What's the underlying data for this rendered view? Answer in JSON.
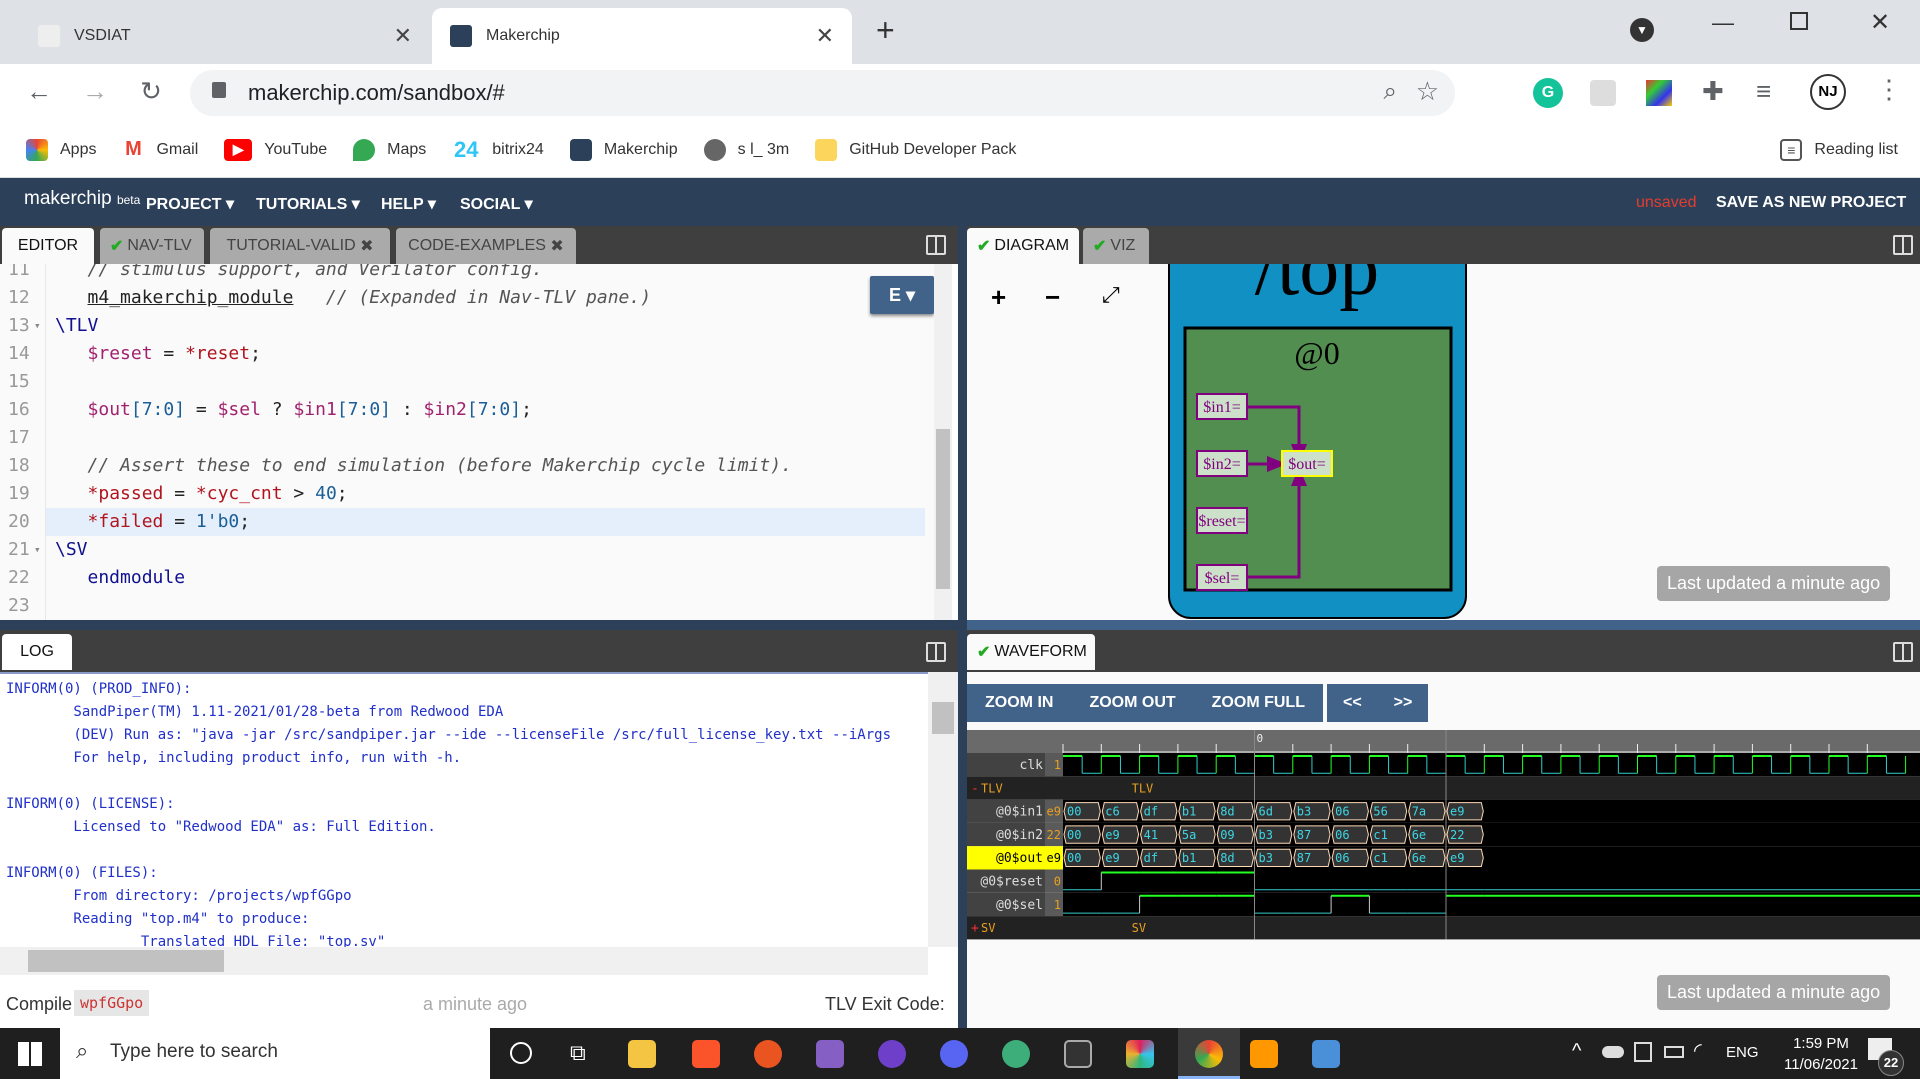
{
  "browser": {
    "tabs": [
      {
        "title": "VSDIAT",
        "active": false
      },
      {
        "title": "Makerchip",
        "active": true
      }
    ],
    "url": "makerchip.com/sandbox/#",
    "bookmarks": [
      {
        "label": "Apps",
        "icon": "apps-grid-icon"
      },
      {
        "label": "Gmail",
        "icon": "gmail-icon"
      },
      {
        "label": "YouTube",
        "icon": "youtube-icon"
      },
      {
        "label": "Maps",
        "icon": "maps-icon"
      },
      {
        "label": "bitrix24",
        "icon": "bitrix24-icon"
      },
      {
        "label": "Makerchip",
        "icon": "makerchip-icon"
      },
      {
        "label": "s l_ 3m",
        "icon": "globe-icon"
      },
      {
        "label": "GitHub Developer Pack",
        "icon": "folder-icon"
      }
    ],
    "reading_list": "Reading list",
    "profile": "NJ"
  },
  "app": {
    "logo": "makerchip",
    "beta": "beta",
    "menu": [
      "PROJECT",
      "TUTORIALS",
      "HELP",
      "SOCIAL"
    ],
    "unsaved": "unsaved",
    "save_as": "SAVE AS NEW PROJECT",
    "accent": "#2c4159"
  },
  "editor": {
    "tabs": [
      {
        "label": "EDITOR",
        "active": true,
        "check": false,
        "close": false
      },
      {
        "label": "NAV-TLV",
        "check": true,
        "close": false
      },
      {
        "label": "TUTORIAL-VALID",
        "check": false,
        "close": true
      },
      {
        "label": "CODE-EXAMPLES",
        "check": false,
        "close": true
      }
    ],
    "e_button": "E",
    "lines": [
      {
        "n": "11",
        "tokens": [
          [
            "   // stimulus support, and Verilator config.",
            "comment"
          ]
        ]
      },
      {
        "n": "12",
        "tokens": [
          [
            "   ",
            "plain"
          ],
          [
            "m4_makerchip_module",
            "link"
          ],
          [
            "   // (Expanded in Nav-TLV pane.)",
            "comment"
          ]
        ]
      },
      {
        "n": "13",
        "fold": true,
        "tokens": [
          [
            "\\TLV",
            "kw"
          ]
        ]
      },
      {
        "n": "14",
        "tokens": [
          [
            "   ",
            "plain"
          ],
          [
            "$reset",
            "var"
          ],
          [
            " = ",
            "plain"
          ],
          [
            "*reset",
            "sig"
          ],
          [
            ";",
            "plain"
          ]
        ]
      },
      {
        "n": "15",
        "tokens": []
      },
      {
        "n": "16",
        "tokens": [
          [
            "   ",
            "plain"
          ],
          [
            "$out",
            "var"
          ],
          [
            "[7:0]",
            "num"
          ],
          [
            " = ",
            "plain"
          ],
          [
            "$sel",
            "var"
          ],
          [
            " ? ",
            "plain"
          ],
          [
            "$in1",
            "var"
          ],
          [
            "[7:0]",
            "num"
          ],
          [
            " : ",
            "plain"
          ],
          [
            "$in2",
            "var"
          ],
          [
            "[7:0]",
            "num"
          ],
          [
            ";",
            "plain"
          ]
        ]
      },
      {
        "n": "17",
        "tokens": []
      },
      {
        "n": "18",
        "tokens": [
          [
            "   // Assert these to end simulation (before Makerchip cycle limit).",
            "comment"
          ]
        ]
      },
      {
        "n": "19",
        "tokens": [
          [
            "   ",
            "plain"
          ],
          [
            "*passed",
            "sig"
          ],
          [
            " = ",
            "plain"
          ],
          [
            "*cyc_cnt",
            "sig"
          ],
          [
            " > ",
            "plain"
          ],
          [
            "40",
            "num"
          ],
          [
            ";",
            "plain"
          ]
        ]
      },
      {
        "n": "20",
        "highlight": true,
        "tokens": [
          [
            "   ",
            "plain"
          ],
          [
            "*failed",
            "sig"
          ],
          [
            " = ",
            "plain"
          ],
          [
            "1'b0",
            "num"
          ],
          [
            ";",
            "plain"
          ]
        ]
      },
      {
        "n": "21",
        "fold": true,
        "tokens": [
          [
            "\\SV",
            "kw"
          ]
        ]
      },
      {
        "n": "22",
        "tokens": [
          [
            "   endmodule",
            "kw"
          ]
        ]
      },
      {
        "n": "23",
        "tokens": []
      }
    ]
  },
  "log": {
    "tab": "LOG",
    "lines": [
      "INFORM(0) (PROD_INFO):",
      "        SandPiper(TM) 1.11-2021/01/28-beta from Redwood EDA",
      "        (DEV) Run as: \"java -jar /src/sandpiper.jar --ide --licenseFile /src/full_license_key.txt --iArgs",
      "        For help, including product info, run with -h.",
      "",
      "INFORM(0) (LICENSE):",
      "        Licensed to \"Redwood EDA\" as: Full Edition.",
      "",
      "INFORM(0) (FILES):",
      "        From directory: /projects/wpfGGpo",
      "        Reading \"top.m4\" to produce:",
      "                Translated HDL File: \"top.sv\""
    ],
    "compile_label": "Compile",
    "compile_id": "wpfGGpo",
    "compile_time": "a minute ago",
    "exit_code": "TLV Exit Code:"
  },
  "diagram": {
    "tabs": [
      {
        "label": "DIAGRAM",
        "active": true
      },
      {
        "label": "VIZ",
        "active": false
      }
    ],
    "controls": [
      "+",
      "−",
      "⤢"
    ],
    "module": "/top",
    "stage": "@0",
    "nodes": [
      "$in1=",
      "$in2=",
      "$out=",
      "$reset=",
      "$sel="
    ],
    "last_updated": "Last updated a minute ago",
    "colors": {
      "module": "#1190c3",
      "stage": "#528e4f",
      "edge": "#800080",
      "highlight": "#ffff00"
    }
  },
  "waveform": {
    "tab": "WAVEFORM",
    "buttons": [
      "ZOOM IN",
      "ZOOM OUT",
      "ZOOM FULL"
    ],
    "nav": [
      "<<",
      ">>"
    ],
    "time_marker": "0",
    "last_updated": "Last updated a minute ago",
    "signals": [
      {
        "name": "clk",
        "value": "1",
        "type": "clock"
      },
      {
        "name": "TLV",
        "type": "group",
        "toggle": "-",
        "label": "TLV"
      },
      {
        "name": "@0$in1",
        "value": "e9",
        "type": "bus",
        "values": [
          "00",
          "c6",
          "df",
          "b1",
          "8d",
          "6d",
          "b3",
          "06",
          "56",
          "7a",
          "e9"
        ]
      },
      {
        "name": "@0$in2",
        "value": "22",
        "type": "bus",
        "values": [
          "00",
          "e9",
          "41",
          "5a",
          "09",
          "b3",
          "87",
          "06",
          "c1",
          "6e",
          "22"
        ]
      },
      {
        "name": "@0$out",
        "value": "e9",
        "type": "bus",
        "selected": true,
        "values": [
          "00",
          "e9",
          "df",
          "b1",
          "8d",
          "b3",
          "87",
          "06",
          "c1",
          "6e",
          "e9"
        ]
      },
      {
        "name": "@0$reset",
        "value": "0",
        "type": "bit",
        "values": [
          0,
          1,
          1,
          1,
          1,
          0,
          0,
          0,
          0,
          0,
          0
        ]
      },
      {
        "name": "@0$sel",
        "value": "1",
        "type": "bit",
        "values": [
          0,
          0,
          1,
          1,
          1,
          0,
          0,
          1,
          0,
          0,
          1
        ]
      },
      {
        "name": "SV",
        "type": "group",
        "toggle": "+",
        "label": "SV"
      }
    ]
  },
  "taskbar": {
    "search_placeholder": "Type here to search",
    "time": "1:59 PM",
    "date": "11/06/2021",
    "lang": "ENG",
    "notifications": "22"
  }
}
